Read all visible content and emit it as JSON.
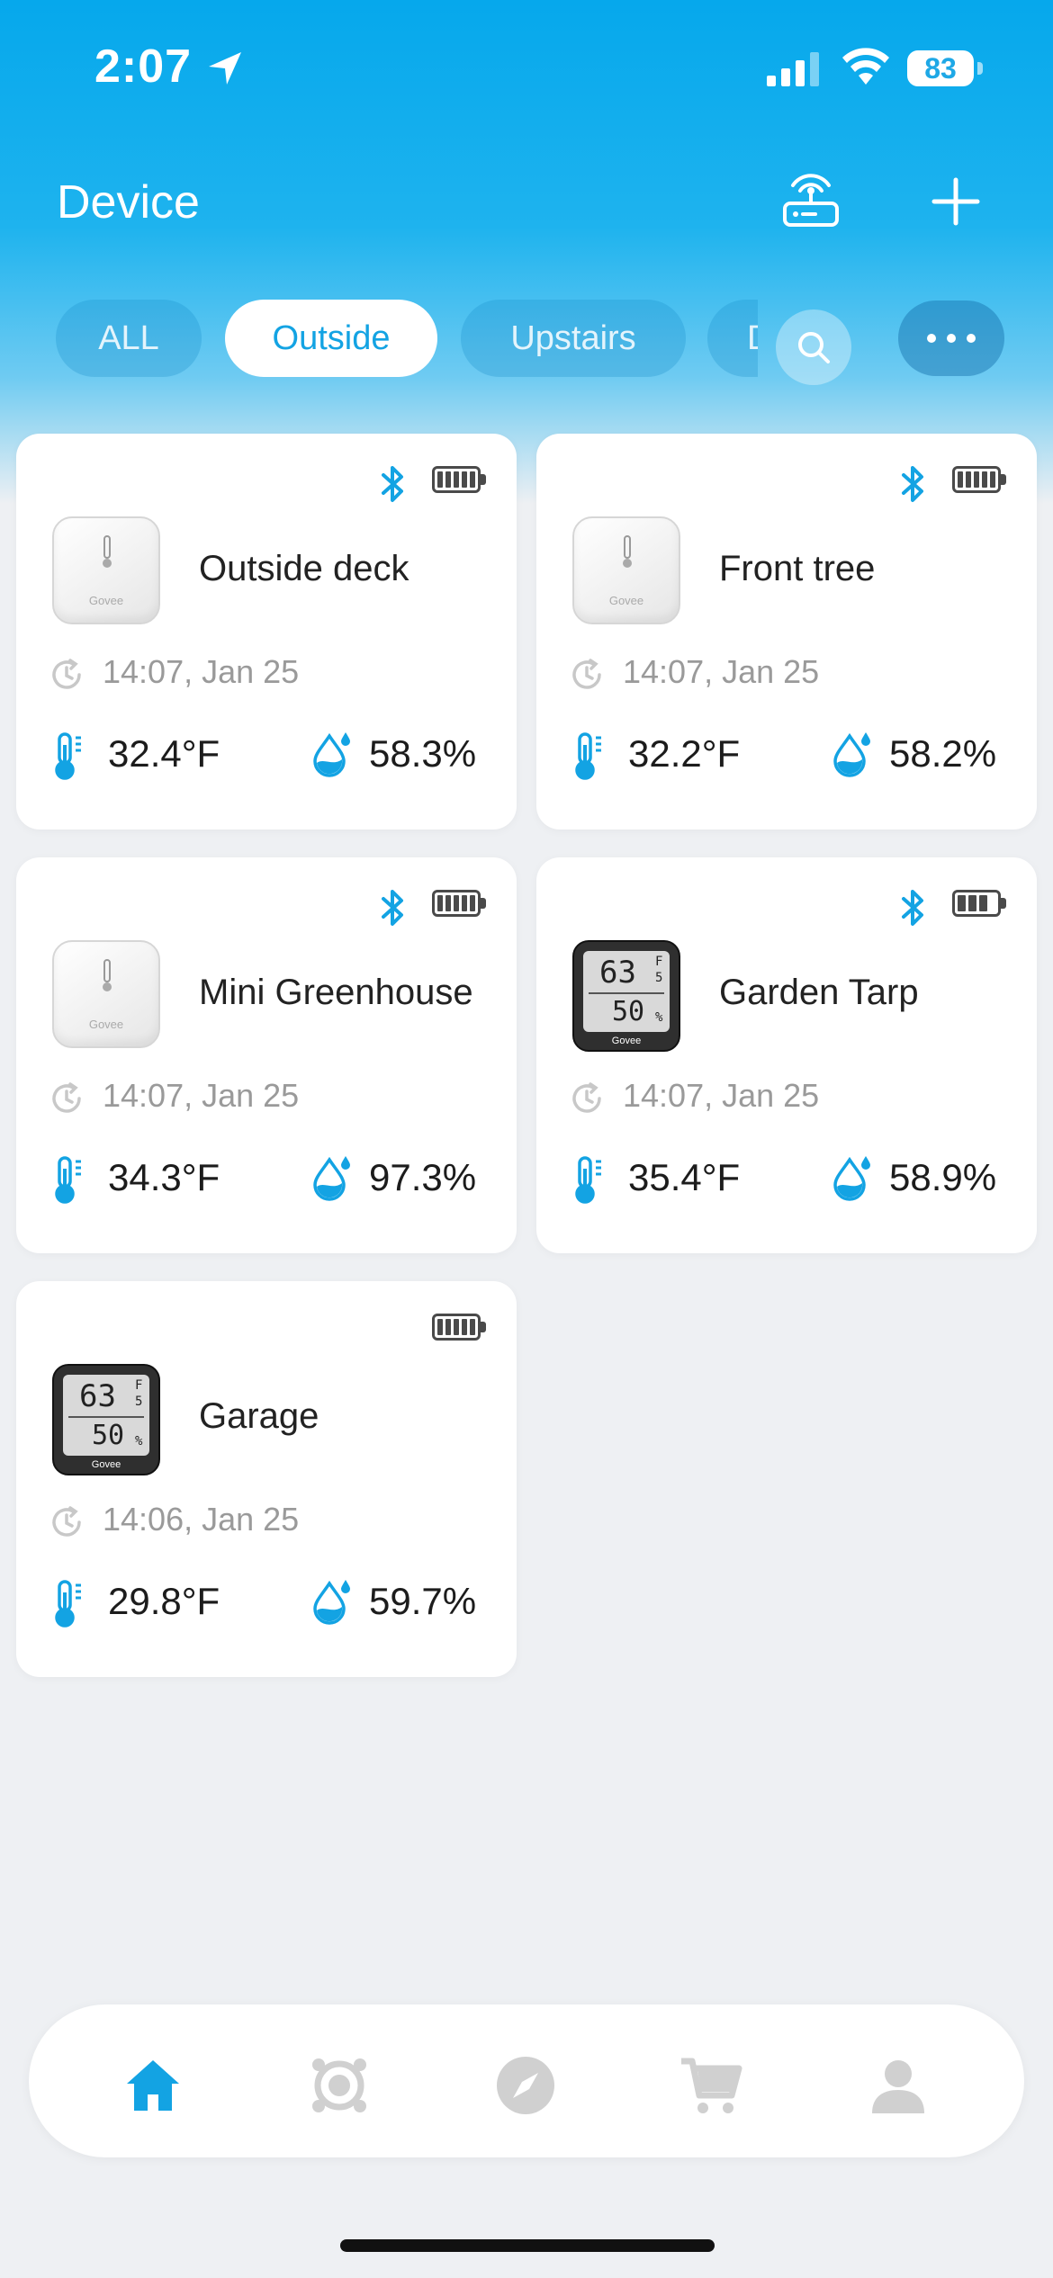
{
  "status_bar": {
    "time": "2:07",
    "battery": "83"
  },
  "header": {
    "title": "Device"
  },
  "tabs": [
    {
      "label": "ALL",
      "active": false
    },
    {
      "label": "Outside",
      "active": true
    },
    {
      "label": "Upstairs",
      "active": false
    },
    {
      "label": "D",
      "active": false
    }
  ],
  "devices": [
    {
      "name": "Outside deck",
      "time": "14:07,  Jan 25",
      "temp": "32.4°F",
      "humidity": "58.3%",
      "bluetooth": true,
      "battery_level": 5,
      "model": "white"
    },
    {
      "name": "Front tree",
      "time": "14:07,  Jan 25",
      "temp": "32.2°F",
      "humidity": "58.2%",
      "bluetooth": true,
      "battery_level": 5,
      "model": "white"
    },
    {
      "name": "Mini Greenhouse",
      "time": "14:07,  Jan 25",
      "temp": "34.3°F",
      "humidity": "97.3%",
      "bluetooth": true,
      "battery_level": 5,
      "model": "white"
    },
    {
      "name": "Garden Tarp",
      "time": "14:07,  Jan 25",
      "temp": "35.4°F",
      "humidity": "58.9%",
      "bluetooth": true,
      "battery_level": 3,
      "model": "lcd"
    },
    {
      "name": "Garage",
      "time": "14:06,  Jan 25",
      "temp": "29.8°F",
      "humidity": "59.7%",
      "bluetooth": false,
      "battery_level": 5,
      "model": "lcd"
    }
  ],
  "sensor_labels": {
    "brand": "Govee",
    "lcd_temp": "63",
    "lcd_temp_decimal": "5",
    "lcd_temp_unit": "F",
    "lcd_humidity": "50",
    "lcd_humidity_unit": "%"
  },
  "nav": [
    {
      "icon": "home-icon",
      "active": true
    },
    {
      "icon": "scenes-icon",
      "active": false
    },
    {
      "icon": "discover-icon",
      "active": false
    },
    {
      "icon": "cart-icon",
      "active": false
    },
    {
      "icon": "profile-icon",
      "active": false
    }
  ],
  "colors": {
    "accent": "#13a3e3",
    "inactive_icon": "#d0d0d0"
  }
}
